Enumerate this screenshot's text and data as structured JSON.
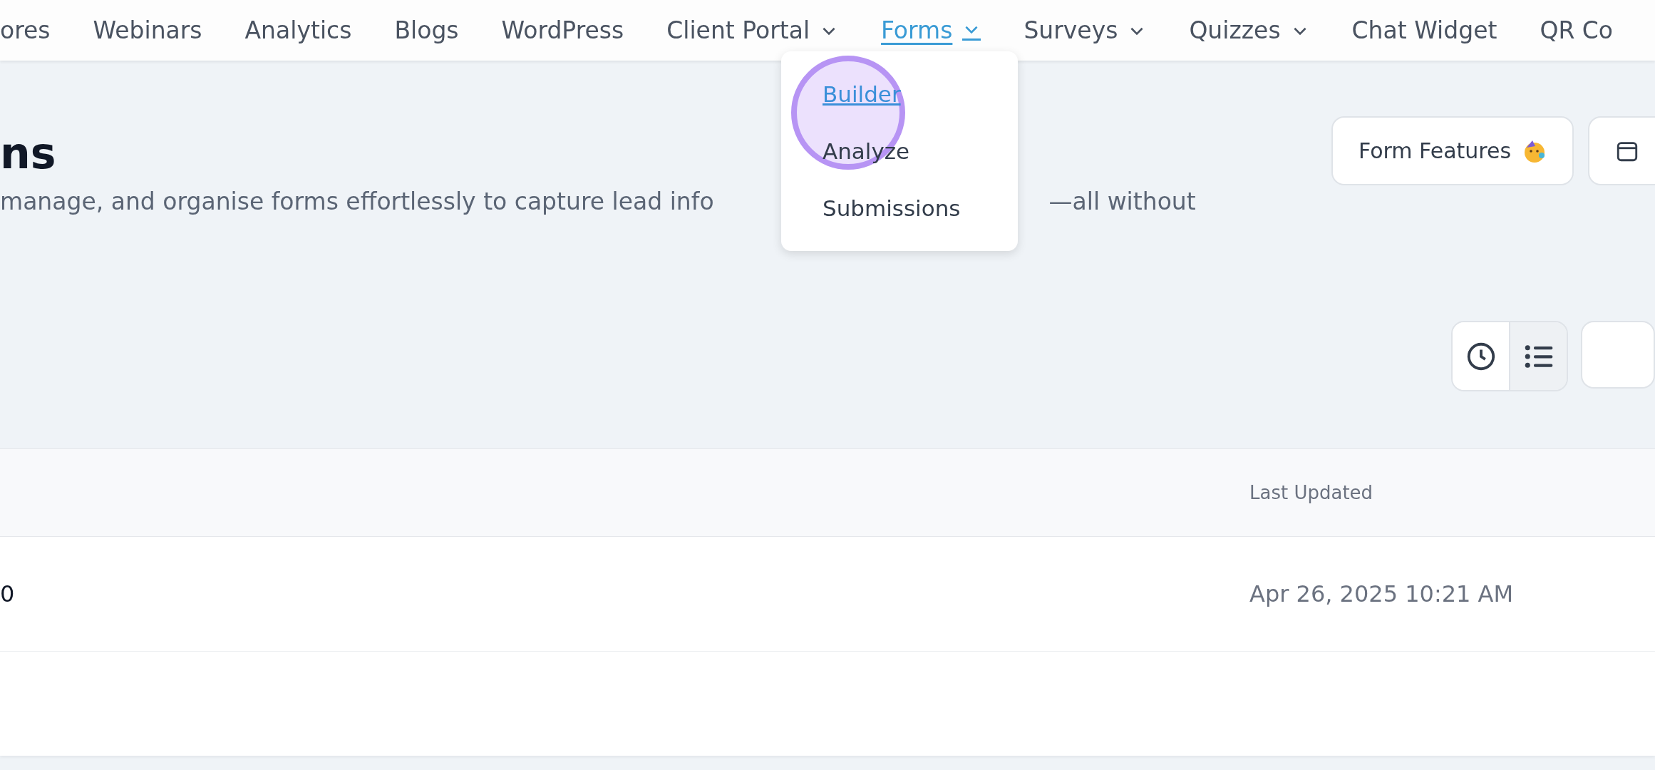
{
  "nav": {
    "items": [
      {
        "label": "ores",
        "has_menu": false,
        "selected": false
      },
      {
        "label": "Webinars",
        "has_menu": false,
        "selected": false
      },
      {
        "label": "Analytics",
        "has_menu": false,
        "selected": false
      },
      {
        "label": "Blogs",
        "has_menu": false,
        "selected": false
      },
      {
        "label": "WordPress",
        "has_menu": false,
        "selected": false
      },
      {
        "label": "Client Portal",
        "has_menu": true,
        "selected": false
      },
      {
        "label": "Forms",
        "has_menu": true,
        "selected": true
      },
      {
        "label": "Surveys",
        "has_menu": true,
        "selected": false
      },
      {
        "label": "Quizzes",
        "has_menu": true,
        "selected": false
      },
      {
        "label": "Chat Widget",
        "has_menu": false,
        "selected": false
      },
      {
        "label": "QR Co",
        "has_menu": false,
        "selected": false
      }
    ]
  },
  "dropdown": {
    "items": [
      {
        "label": "Builder",
        "selected": true
      },
      {
        "label": "Analyze",
        "selected": false
      },
      {
        "label": "Submissions",
        "selected": false
      }
    ]
  },
  "page": {
    "title": "ns",
    "subtitle_start": "manage, and organise forms effortlessly to capture lead info",
    "subtitle_end": "—all without"
  },
  "actions": {
    "form_features": "Form Features"
  },
  "view_toggle": [
    {
      "kind": "clock",
      "selected": false
    },
    {
      "kind": "list",
      "selected": true
    }
  ],
  "table": {
    "column_header": "Last Updated",
    "rows": [
      {
        "column_1": "0",
        "last_updated": "Apr 26, 2025 10:21 AM"
      }
    ]
  }
}
